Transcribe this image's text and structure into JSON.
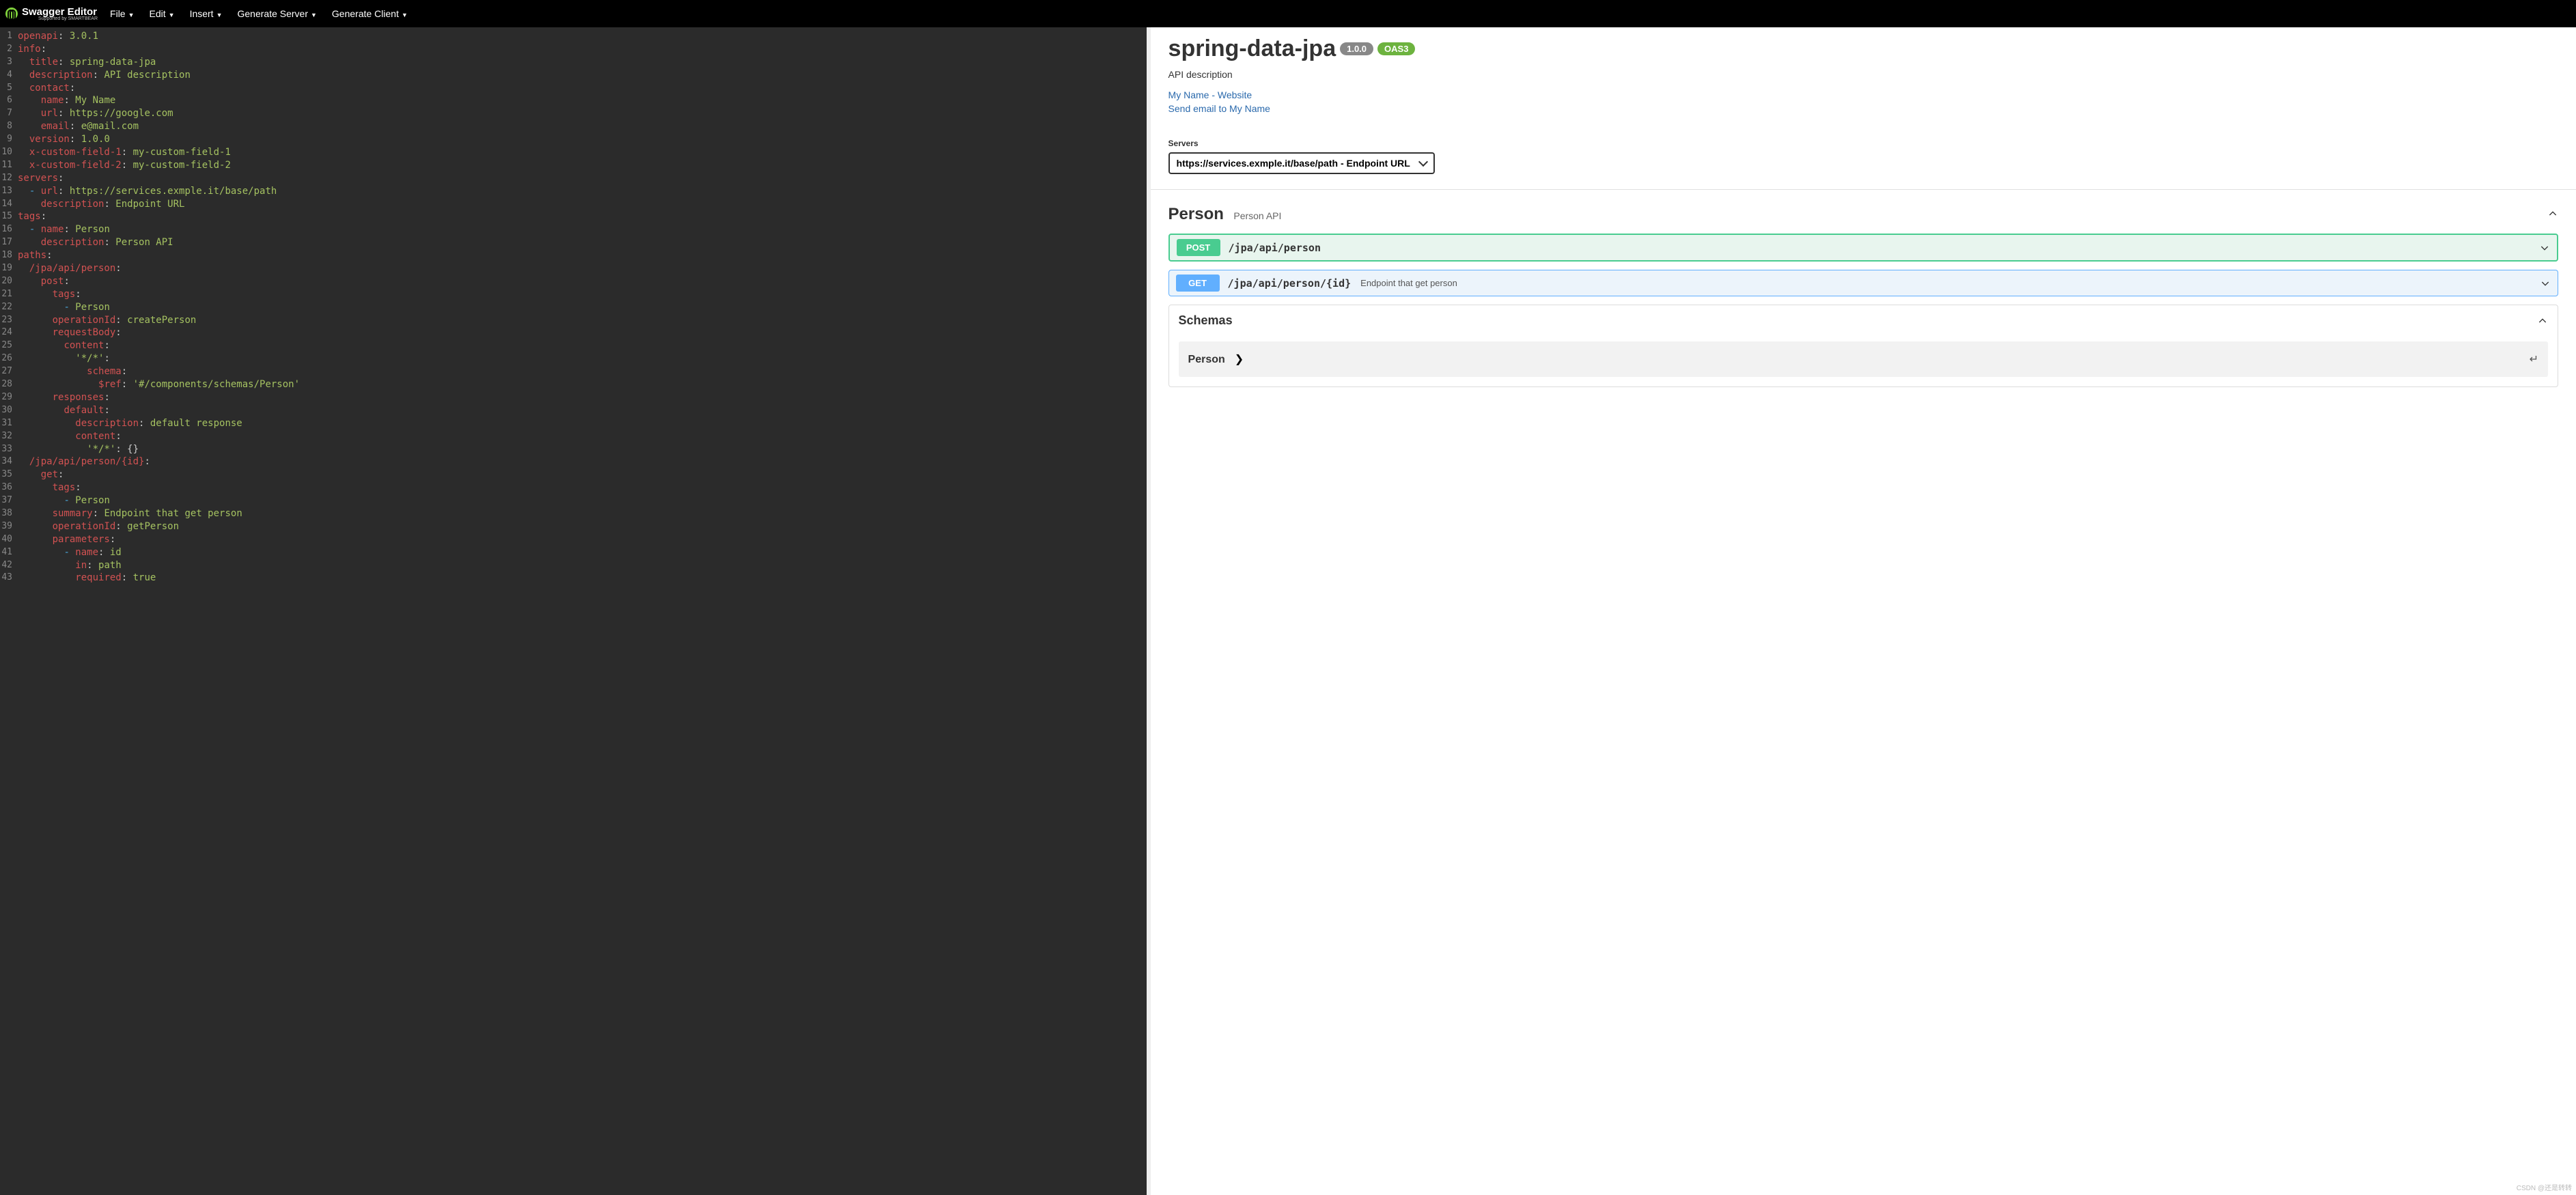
{
  "topbar": {
    "brand": "Swagger Editor",
    "brand_sub": "Supported by SMARTBEAR",
    "menu": [
      "File",
      "Edit",
      "Insert",
      "Generate Server",
      "Generate Client"
    ]
  },
  "editor": {
    "lines": [
      {
        "n": 1,
        "seg": [
          {
            "c": "k-key",
            "t": "openapi"
          },
          {
            "c": "k-pun",
            "t": ": "
          },
          {
            "c": "k-num",
            "t": "3.0.1"
          }
        ]
      },
      {
        "n": 2,
        "fold": true,
        "seg": [
          {
            "c": "k-key",
            "t": "info"
          },
          {
            "c": "k-pun",
            "t": ":"
          }
        ]
      },
      {
        "n": 3,
        "seg": [
          {
            "c": "",
            "t": "  "
          },
          {
            "c": "k-key",
            "t": "title"
          },
          {
            "c": "k-pun",
            "t": ": "
          },
          {
            "c": "k-str",
            "t": "spring-data-jpa"
          }
        ]
      },
      {
        "n": 4,
        "seg": [
          {
            "c": "",
            "t": "  "
          },
          {
            "c": "k-key",
            "t": "description"
          },
          {
            "c": "k-pun",
            "t": ": "
          },
          {
            "c": "k-str",
            "t": "API description"
          }
        ]
      },
      {
        "n": 5,
        "fold": true,
        "seg": [
          {
            "c": "",
            "t": "  "
          },
          {
            "c": "k-key",
            "t": "contact"
          },
          {
            "c": "k-pun",
            "t": ":"
          }
        ]
      },
      {
        "n": 6,
        "seg": [
          {
            "c": "",
            "t": "    "
          },
          {
            "c": "k-key",
            "t": "name"
          },
          {
            "c": "k-pun",
            "t": ": "
          },
          {
            "c": "k-str",
            "t": "My Name"
          }
        ]
      },
      {
        "n": 7,
        "seg": [
          {
            "c": "",
            "t": "    "
          },
          {
            "c": "k-key",
            "t": "url"
          },
          {
            "c": "k-pun",
            "t": ": "
          },
          {
            "c": "k-str",
            "t": "https://google.com"
          }
        ]
      },
      {
        "n": 8,
        "seg": [
          {
            "c": "",
            "t": "    "
          },
          {
            "c": "k-key",
            "t": "email"
          },
          {
            "c": "k-pun",
            "t": ": "
          },
          {
            "c": "k-str",
            "t": "e@mail.com"
          }
        ]
      },
      {
        "n": 9,
        "seg": [
          {
            "c": "",
            "t": "  "
          },
          {
            "c": "k-key",
            "t": "version"
          },
          {
            "c": "k-pun",
            "t": ": "
          },
          {
            "c": "k-num",
            "t": "1.0.0"
          }
        ]
      },
      {
        "n": 10,
        "seg": [
          {
            "c": "",
            "t": "  "
          },
          {
            "c": "k-key",
            "t": "x-custom-field-1"
          },
          {
            "c": "k-pun",
            "t": ": "
          },
          {
            "c": "k-str",
            "t": "my-custom-field-1"
          }
        ]
      },
      {
        "n": 11,
        "seg": [
          {
            "c": "",
            "t": "  "
          },
          {
            "c": "k-key",
            "t": "x-custom-field-2"
          },
          {
            "c": "k-pun",
            "t": ": "
          },
          {
            "c": "k-str",
            "t": "my-custom-field-2"
          }
        ]
      },
      {
        "n": 12,
        "fold": true,
        "seg": [
          {
            "c": "k-key",
            "t": "servers"
          },
          {
            "c": "k-pun",
            "t": ":"
          }
        ]
      },
      {
        "n": 13,
        "seg": [
          {
            "c": "",
            "t": "  "
          },
          {
            "c": "k-ind",
            "t": "- "
          },
          {
            "c": "k-key",
            "t": "url"
          },
          {
            "c": "k-pun",
            "t": ": "
          },
          {
            "c": "k-str",
            "t": "https://services.exmple.it/base/path"
          }
        ]
      },
      {
        "n": 14,
        "seg": [
          {
            "c": "",
            "t": "    "
          },
          {
            "c": "k-key",
            "t": "description"
          },
          {
            "c": "k-pun",
            "t": ": "
          },
          {
            "c": "k-str",
            "t": "Endpoint URL"
          }
        ]
      },
      {
        "n": 15,
        "fold": true,
        "seg": [
          {
            "c": "k-key",
            "t": "tags"
          },
          {
            "c": "k-pun",
            "t": ":"
          }
        ]
      },
      {
        "n": 16,
        "seg": [
          {
            "c": "",
            "t": "  "
          },
          {
            "c": "k-ind",
            "t": "- "
          },
          {
            "c": "k-key",
            "t": "name"
          },
          {
            "c": "k-pun",
            "t": ": "
          },
          {
            "c": "k-str",
            "t": "Person"
          }
        ]
      },
      {
        "n": 17,
        "seg": [
          {
            "c": "",
            "t": "    "
          },
          {
            "c": "k-key",
            "t": "description"
          },
          {
            "c": "k-pun",
            "t": ": "
          },
          {
            "c": "k-str",
            "t": "Person API"
          }
        ]
      },
      {
        "n": 18,
        "fold": true,
        "seg": [
          {
            "c": "k-key",
            "t": "paths"
          },
          {
            "c": "k-pun",
            "t": ":"
          }
        ]
      },
      {
        "n": 19,
        "fold": true,
        "seg": [
          {
            "c": "",
            "t": "  "
          },
          {
            "c": "k-key",
            "t": "/jpa/api/person"
          },
          {
            "c": "k-pun",
            "t": ":"
          }
        ]
      },
      {
        "n": 20,
        "fold": true,
        "seg": [
          {
            "c": "",
            "t": "    "
          },
          {
            "c": "k-key",
            "t": "post"
          },
          {
            "c": "k-pun",
            "t": ":"
          }
        ]
      },
      {
        "n": 21,
        "fold": true,
        "seg": [
          {
            "c": "",
            "t": "      "
          },
          {
            "c": "k-key",
            "t": "tags"
          },
          {
            "c": "k-pun",
            "t": ":"
          }
        ]
      },
      {
        "n": 22,
        "seg": [
          {
            "c": "",
            "t": "        "
          },
          {
            "c": "k-ind",
            "t": "- "
          },
          {
            "c": "k-str",
            "t": "Person"
          }
        ]
      },
      {
        "n": 23,
        "seg": [
          {
            "c": "",
            "t": "      "
          },
          {
            "c": "k-key",
            "t": "operationId"
          },
          {
            "c": "k-pun",
            "t": ": "
          },
          {
            "c": "k-str",
            "t": "createPerson"
          }
        ]
      },
      {
        "n": 24,
        "fold": true,
        "seg": [
          {
            "c": "",
            "t": "      "
          },
          {
            "c": "k-key",
            "t": "requestBody"
          },
          {
            "c": "k-pun",
            "t": ":"
          }
        ]
      },
      {
        "n": 25,
        "fold": true,
        "seg": [
          {
            "c": "",
            "t": "        "
          },
          {
            "c": "k-key",
            "t": "content"
          },
          {
            "c": "k-pun",
            "t": ":"
          }
        ]
      },
      {
        "n": 26,
        "fold": true,
        "seg": [
          {
            "c": "",
            "t": "          "
          },
          {
            "c": "k-str",
            "t": "'*/*'"
          },
          {
            "c": "k-pun",
            "t": ":"
          }
        ]
      },
      {
        "n": 27,
        "fold": true,
        "seg": [
          {
            "c": "",
            "t": "            "
          },
          {
            "c": "k-key",
            "t": "schema"
          },
          {
            "c": "k-pun",
            "t": ":"
          }
        ]
      },
      {
        "n": 28,
        "seg": [
          {
            "c": "",
            "t": "              "
          },
          {
            "c": "k-key",
            "t": "$ref"
          },
          {
            "c": "k-pun",
            "t": ": "
          },
          {
            "c": "k-str",
            "t": "'#/components/schemas/Person'"
          }
        ]
      },
      {
        "n": 29,
        "fold": true,
        "seg": [
          {
            "c": "",
            "t": "      "
          },
          {
            "c": "k-key",
            "t": "responses"
          },
          {
            "c": "k-pun",
            "t": ":"
          }
        ]
      },
      {
        "n": 30,
        "fold": true,
        "seg": [
          {
            "c": "",
            "t": "        "
          },
          {
            "c": "k-key",
            "t": "default"
          },
          {
            "c": "k-pun",
            "t": ":"
          }
        ]
      },
      {
        "n": 31,
        "seg": [
          {
            "c": "",
            "t": "          "
          },
          {
            "c": "k-key",
            "t": "description"
          },
          {
            "c": "k-pun",
            "t": ": "
          },
          {
            "c": "k-str",
            "t": "default response"
          }
        ]
      },
      {
        "n": 32,
        "fold": true,
        "seg": [
          {
            "c": "",
            "t": "          "
          },
          {
            "c": "k-key",
            "t": "content"
          },
          {
            "c": "k-pun",
            "t": ":"
          }
        ]
      },
      {
        "n": 33,
        "seg": [
          {
            "c": "",
            "t": "            "
          },
          {
            "c": "k-str",
            "t": "'*/*'"
          },
          {
            "c": "k-pun",
            "t": ": "
          },
          {
            "c": "k-pun",
            "t": "{}"
          }
        ]
      },
      {
        "n": 34,
        "fold": true,
        "seg": [
          {
            "c": "",
            "t": "  "
          },
          {
            "c": "k-key",
            "t": "/jpa/api/person/{id}"
          },
          {
            "c": "k-pun",
            "t": ":"
          }
        ]
      },
      {
        "n": 35,
        "fold": true,
        "seg": [
          {
            "c": "",
            "t": "    "
          },
          {
            "c": "k-key",
            "t": "get"
          },
          {
            "c": "k-pun",
            "t": ":"
          }
        ]
      },
      {
        "n": 36,
        "fold": true,
        "seg": [
          {
            "c": "",
            "t": "      "
          },
          {
            "c": "k-key",
            "t": "tags"
          },
          {
            "c": "k-pun",
            "t": ":"
          }
        ]
      },
      {
        "n": 37,
        "seg": [
          {
            "c": "",
            "t": "        "
          },
          {
            "c": "k-ind",
            "t": "- "
          },
          {
            "c": "k-str",
            "t": "Person"
          }
        ]
      },
      {
        "n": 38,
        "seg": [
          {
            "c": "",
            "t": "      "
          },
          {
            "c": "k-key",
            "t": "summary"
          },
          {
            "c": "k-pun",
            "t": ": "
          },
          {
            "c": "k-str",
            "t": "Endpoint that get person"
          }
        ]
      },
      {
        "n": 39,
        "seg": [
          {
            "c": "",
            "t": "      "
          },
          {
            "c": "k-key",
            "t": "operationId"
          },
          {
            "c": "k-pun",
            "t": ": "
          },
          {
            "c": "k-str",
            "t": "getPerson"
          }
        ]
      },
      {
        "n": 40,
        "fold": true,
        "seg": [
          {
            "c": "",
            "t": "      "
          },
          {
            "c": "k-key",
            "t": "parameters"
          },
          {
            "c": "k-pun",
            "t": ":"
          }
        ]
      },
      {
        "n": 41,
        "seg": [
          {
            "c": "",
            "t": "        "
          },
          {
            "c": "k-ind",
            "t": "- "
          },
          {
            "c": "k-key",
            "t": "name"
          },
          {
            "c": "k-pun",
            "t": ": "
          },
          {
            "c": "k-str",
            "t": "id"
          }
        ]
      },
      {
        "n": 42,
        "seg": [
          {
            "c": "",
            "t": "          "
          },
          {
            "c": "k-key",
            "t": "in"
          },
          {
            "c": "k-pun",
            "t": ": "
          },
          {
            "c": "k-str",
            "t": "path"
          }
        ]
      },
      {
        "n": 43,
        "seg": [
          {
            "c": "",
            "t": "          "
          },
          {
            "c": "k-key",
            "t": "required"
          },
          {
            "c": "k-pun",
            "t": ": "
          },
          {
            "c": "k-num",
            "t": "true"
          }
        ]
      }
    ]
  },
  "preview": {
    "title": "spring-data-jpa",
    "version": "1.0.0",
    "oas": "OAS3",
    "description": "API description",
    "links": {
      "contact": "My Name - Website",
      "email": "Send email to My Name"
    },
    "servers_label": "Servers",
    "server_selected": "https://services.exmple.it/base/path - Endpoint URL",
    "tag": {
      "name": "Person",
      "desc": "Person API"
    },
    "ops": [
      {
        "method": "POST",
        "path": "/jpa/api/person",
        "summary": "",
        "cls": "op-post"
      },
      {
        "method": "GET",
        "path": "/jpa/api/person/{id}",
        "summary": "Endpoint that get person",
        "cls": "op-get"
      }
    ],
    "schemas_label": "Schemas",
    "schema_items": [
      "Person"
    ]
  },
  "watermark": "CSDN @还是转转"
}
